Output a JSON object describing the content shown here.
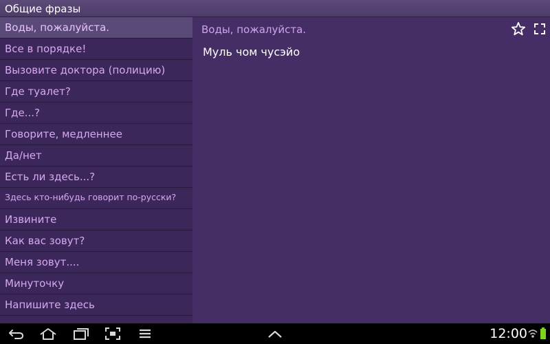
{
  "app": {
    "title": "Общие фразы"
  },
  "phrases": [
    {
      "label": "Воды, пожалуйста.",
      "selected": true
    },
    {
      "label": "Все в порядке!"
    },
    {
      "label": "Вызовите доктора (полицию)"
    },
    {
      "label": "Где туалет?"
    },
    {
      "label": "Где...?"
    },
    {
      "label": "Говорите, медленнее"
    },
    {
      "label": "Да/нет"
    },
    {
      "label": "Есть ли здесь...?"
    },
    {
      "label": "Здесь кто-нибудь говорит по-русски?"
    },
    {
      "label": "Извините"
    },
    {
      "label": "Как вас зовут?"
    },
    {
      "label": "Меня зовут...."
    },
    {
      "label": "Минуточку"
    },
    {
      "label": "Напишите здесь"
    }
  ],
  "detail": {
    "source": "Воды, пожалуйста.",
    "translation": "Муль чом чусэйо",
    "icons": [
      "star-outline-icon",
      "fullscreen-icon"
    ]
  },
  "statusbar": {
    "time": "12:00",
    "icons": [
      "back-icon",
      "home-icon",
      "recent-apps-icon",
      "screenshot-icon",
      "menu-icon",
      "chevron-up-icon",
      "wifi-icon",
      "battery-icon"
    ]
  },
  "colors": {
    "background": "#432c63",
    "list_text": "#d6a8f0",
    "selected_row": "#5a4a78",
    "translation_text": "#ffffff",
    "battery": "#7ed321"
  }
}
